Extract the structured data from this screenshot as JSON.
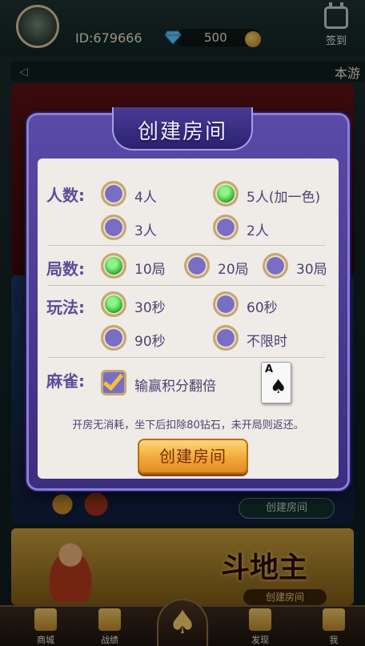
{
  "header": {
    "id_text": "ID:679666",
    "diamonds": "500",
    "signin_label": "签到",
    "notice_text": "本游"
  },
  "lobby": {
    "create_room_button": "创建房间",
    "game_title": "斗地主",
    "game_button": "创建房间"
  },
  "dialog": {
    "title": "创建房间",
    "rows": {
      "players": {
        "label": "人数:",
        "options": [
          {
            "label": "4人",
            "selected": false
          },
          {
            "label": "5人(加一色)",
            "selected": true
          },
          {
            "label": "3人",
            "selected": false
          },
          {
            "label": "2人",
            "selected": false
          }
        ]
      },
      "rounds": {
        "label": "局数:",
        "options": [
          {
            "label": "10局",
            "selected": true
          },
          {
            "label": "20局",
            "selected": false
          },
          {
            "label": "30局",
            "selected": false
          }
        ]
      },
      "play": {
        "label": "玩法:",
        "options": [
          {
            "label": "30秒",
            "selected": true
          },
          {
            "label": "60秒",
            "selected": false
          },
          {
            "label": "90秒",
            "selected": false
          },
          {
            "label": "不限时",
            "selected": false
          }
        ]
      },
      "mahjong": {
        "label": "麻雀:",
        "checkbox_label": "输赢积分翻倍",
        "checked": true
      }
    },
    "card": {
      "rank": "A",
      "suit": "♠"
    },
    "note": "开房无消耗，坐下后扣除80钻石，未开局则返还。",
    "create_button": "创建房间"
  },
  "nav": {
    "items": [
      {
        "label": "商城",
        "icon": "cart-icon"
      },
      {
        "label": "战绩",
        "icon": "bar-chart-icon"
      },
      {
        "label": "",
        "icon": "spade-icon"
      },
      {
        "label": "发现",
        "icon": "search-list-icon"
      },
      {
        "label": "我",
        "icon": "user-icon"
      }
    ],
    "center_glyph": "♠"
  },
  "colors": {
    "dialog_bg": "#4b3c96",
    "panel_bg": "#efebe6",
    "label_color": "#5a4e9a",
    "radio_selected": "#39b93a",
    "button_orange": "#f0a93a"
  }
}
